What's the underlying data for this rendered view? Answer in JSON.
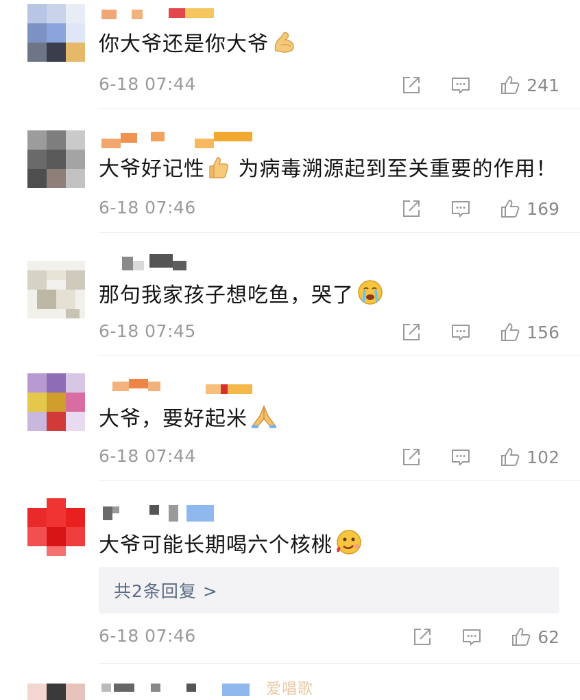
{
  "comments": [
    {
      "text": "你大爷还是你大爷",
      "emoji": "flexed-biceps",
      "time": "6-18 07:44",
      "likes": "241"
    },
    {
      "text": "大爷好记性",
      "emoji": "thumbs-up",
      "text_after": "为病毒溯源起到至关重要的作用！",
      "time": "6-18 07:46",
      "likes": "169"
    },
    {
      "text": "那句我家孩子想吃鱼，哭了",
      "emoji": "crying-face",
      "time": "6-18 07:45",
      "likes": "156"
    },
    {
      "text": "大爷，要好起米",
      "emoji": "folded-hands",
      "time": "6-18 07:44",
      "likes": "102"
    },
    {
      "text": "大爷可能长期喝六个核桃",
      "emoji": "drooling-face",
      "reply_summary": "共2条回复 >",
      "time": "6-18 07:46",
      "likes": "62"
    }
  ],
  "watermark": "爱唱歌",
  "colors": {
    "time": "#9a9a9a",
    "like_count": "#8a8a8a",
    "reply_link": "#5b6b86",
    "reply_bg": "#f3f3f5",
    "icon": "#9a9a9a"
  }
}
